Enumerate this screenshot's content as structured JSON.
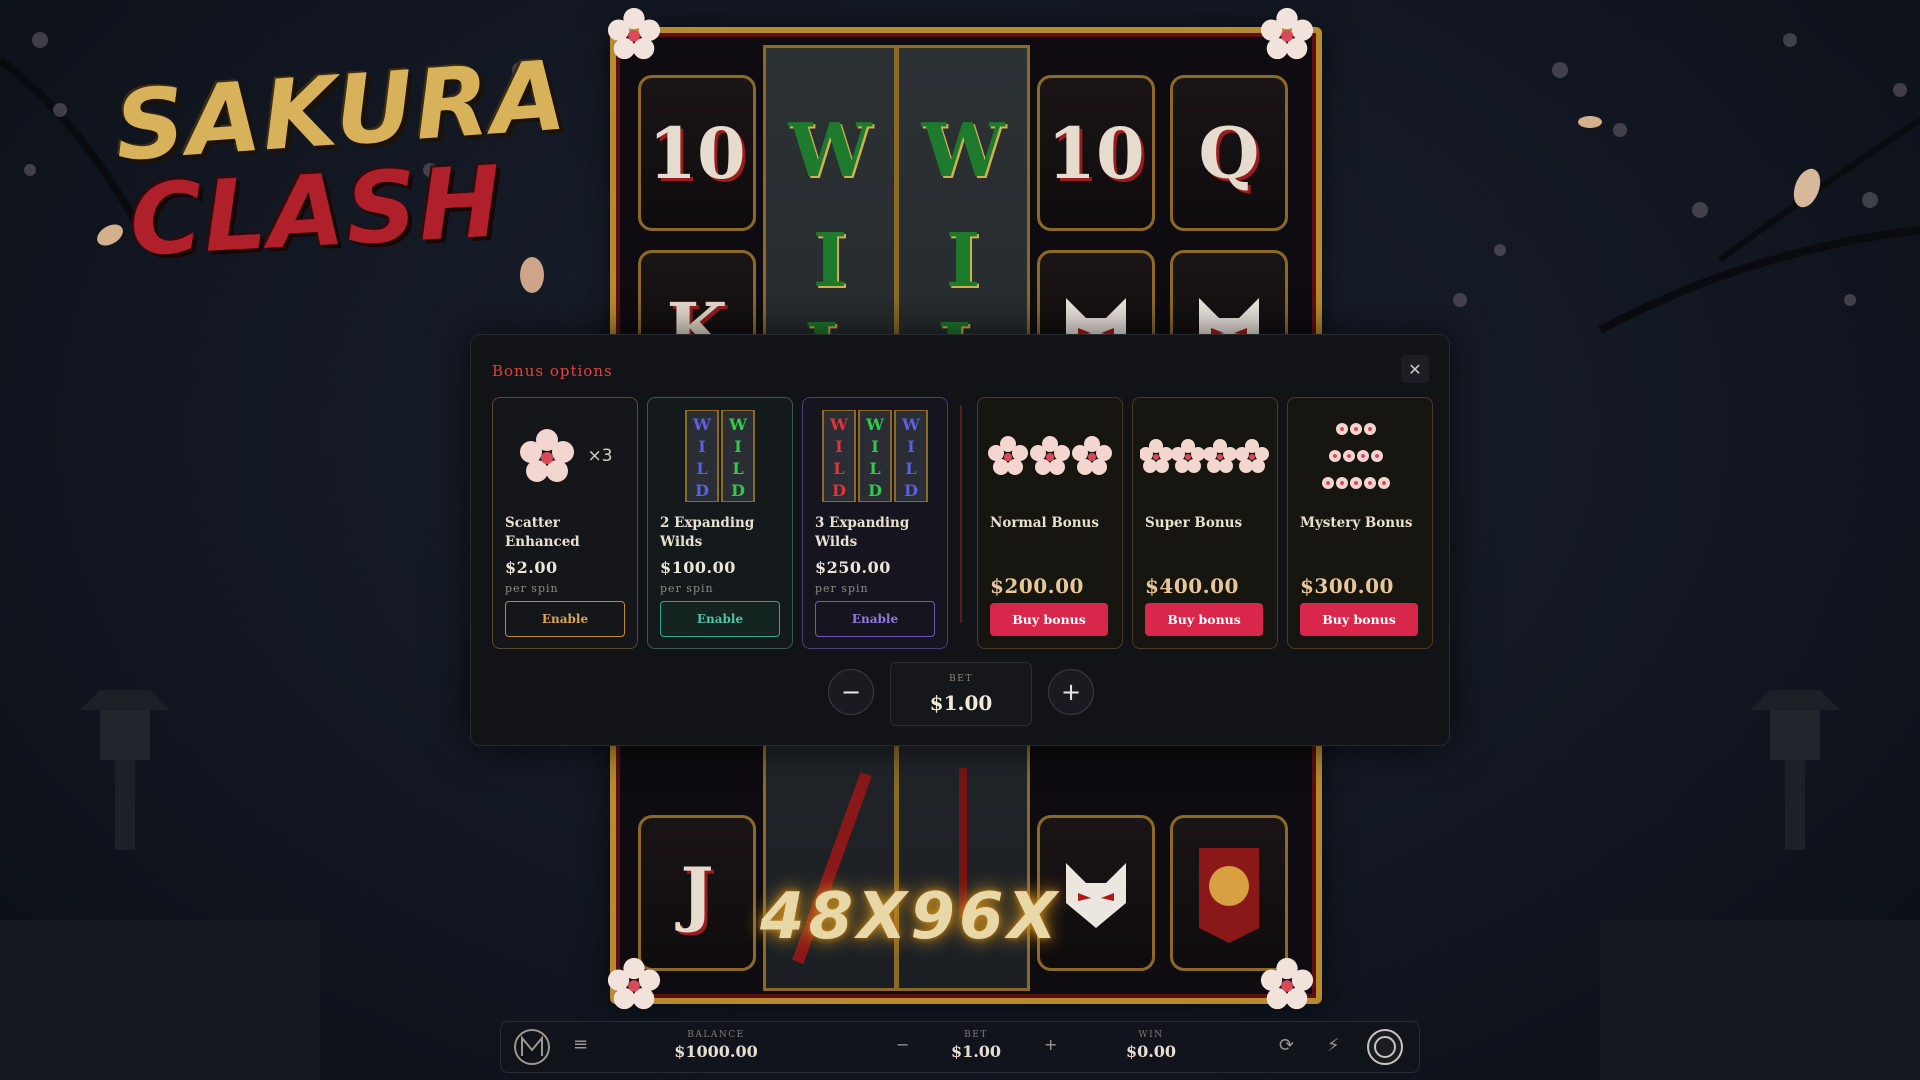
{
  "logo": {
    "line1": "SAKURA",
    "line2": "CLASH"
  },
  "reels": {
    "top_symbols": [
      "10",
      "10",
      "Q"
    ],
    "second_symbols": [
      "K"
    ],
    "bottom_symbols": [
      "J"
    ],
    "wild_letters": [
      "W",
      "I",
      "L"
    ],
    "multiplier": "48X96X"
  },
  "modal": {
    "title": "Bonus options",
    "close_icon": "close-icon",
    "cards": [
      {
        "name": "Scatter Enhanced",
        "price": "$2.00",
        "per": "per spin",
        "button": "Enable",
        "art_badge": "×3"
      },
      {
        "name": "2 Expanding Wilds",
        "price": "$100.00",
        "per": "per spin",
        "button": "Enable"
      },
      {
        "name": "3 Expanding Wilds",
        "price": "$250.00",
        "per": "per spin",
        "button": "Enable"
      },
      {
        "name": "Normal Bonus",
        "price": "$200.00",
        "button": "Buy bonus"
      },
      {
        "name": "Super Bonus",
        "price": "$400.00",
        "button": "Buy bonus"
      },
      {
        "name": "Mystery Bonus",
        "price": "$300.00",
        "button": "Buy bonus"
      }
    ],
    "bet": {
      "label": "BET",
      "value": "$1.00",
      "minus": "−",
      "plus": "+"
    }
  },
  "bottom_bar": {
    "balance_label": "BALANCE",
    "balance": "$1000.00",
    "bet_label": "BET",
    "bet": "$1.00",
    "win_label": "WIN",
    "win": "$0.00",
    "minus": "−",
    "plus": "+",
    "menu_icon": "menu-icon"
  },
  "colors": {
    "accent_red": "#d8274a",
    "gold": "#b88a2e",
    "title_red": "#e3403f"
  }
}
